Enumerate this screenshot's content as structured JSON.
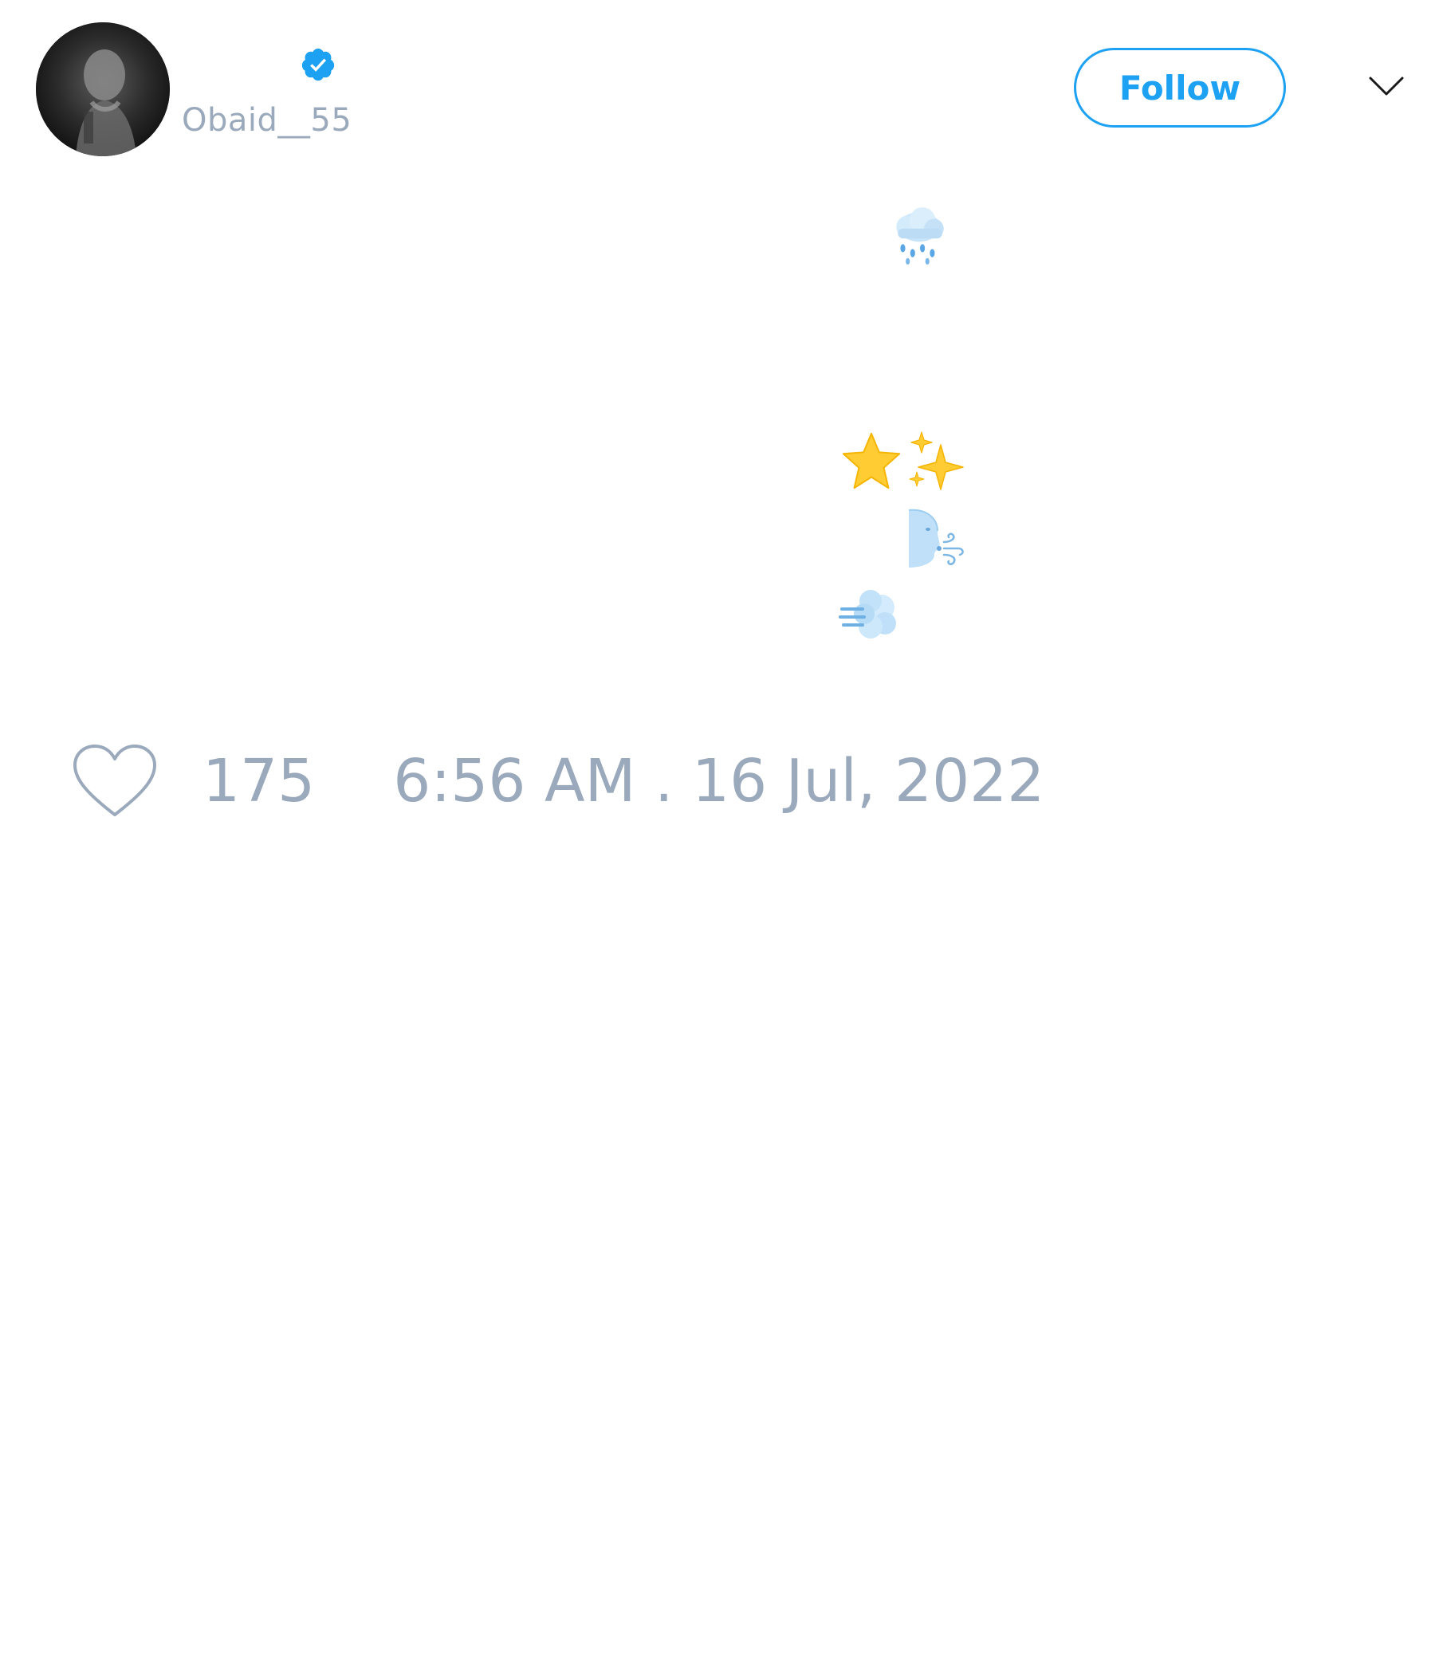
{
  "author": {
    "handle": "Obaid__55",
    "verified": true,
    "avatar_icon": "user-avatar-photo"
  },
  "header": {
    "follow_label": "Follow",
    "menu_icon": "chevron-down-icon"
  },
  "tweet": {
    "emojis": [
      "🌨️",
      "⭐",
      "✨",
      "🌬️",
      "💨"
    ]
  },
  "footer": {
    "like_icon": "heart-outline-icon",
    "like_count": "175",
    "timestamp": "6:56 AM . 16 Jul, 2022"
  },
  "colors": {
    "accent": "#1da1f2",
    "muted_text": "#9aa9bb",
    "background": "#ffffff"
  }
}
